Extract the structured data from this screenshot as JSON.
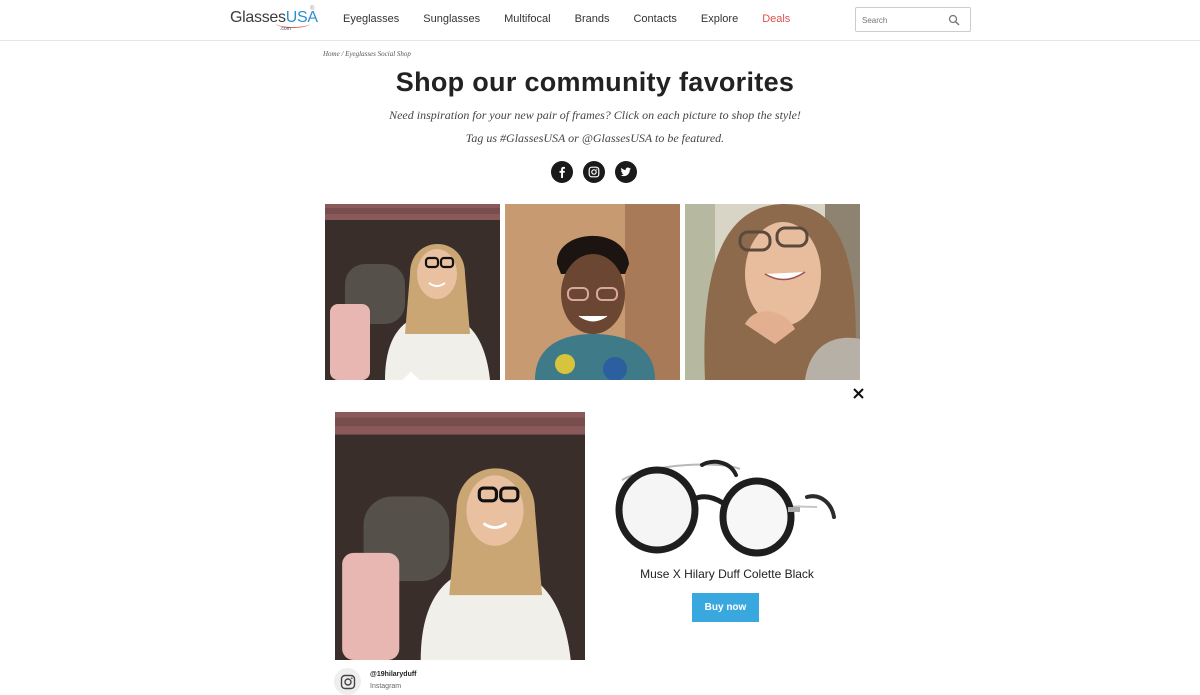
{
  "header": {
    "logo": {
      "main": "Glasses",
      "accent": "USA",
      "suffix": ".com",
      "tm": "®"
    },
    "nav": [
      "Eyeglasses",
      "Sunglasses",
      "Multifocal",
      "Brands",
      "Contacts",
      "Explore",
      "Deals"
    ],
    "search": {
      "placeholder": "Search"
    }
  },
  "breadcrumb": {
    "home": "Home",
    "separator": "/",
    "current": "Eyeglasses Social Shop"
  },
  "hero": {
    "title": "Shop our community favorites",
    "subtitle_1": "Need inspiration for your new pair of frames? Click on each picture to shop the style!",
    "subtitle_2": "Tag us #GlassesUSA or @GlassesUSA to be featured."
  },
  "social_icons": [
    "facebook-icon",
    "instagram-icon",
    "twitter-icon"
  ],
  "gallery": {
    "photos": [
      "community-photo-1",
      "community-photo-2",
      "community-photo-3"
    ],
    "selected_index": 0
  },
  "detail": {
    "handle": "@19hilaryduff",
    "source": "Instagram",
    "product_name": "Muse X Hilary Duff Colette Black",
    "buy_label": "Buy now"
  },
  "colors": {
    "accent_blue": "#38a8df",
    "deals_red": "#d9534f",
    "logo_blue": "#2a8fd0"
  }
}
